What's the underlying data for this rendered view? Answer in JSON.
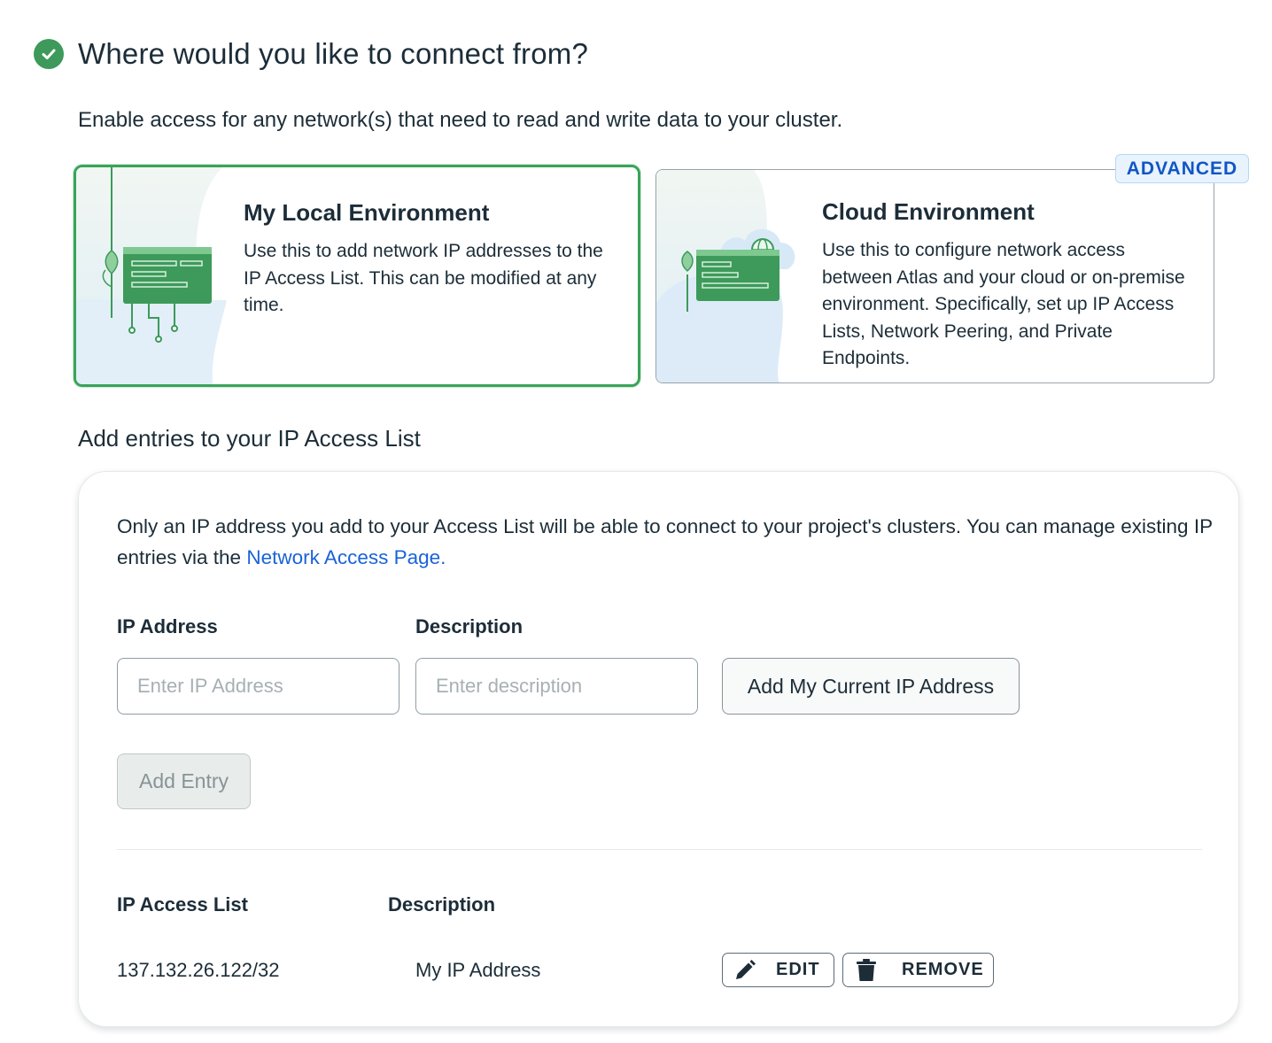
{
  "step": {
    "title": "Where would you like to connect from?",
    "intro": "Enable access for any network(s) that need to read and write data to your cluster."
  },
  "environments": [
    {
      "title": "My Local Environment",
      "description": "Use this to add network IP addresses to the IP Access List. This can be modified at any time.",
      "selected": true
    },
    {
      "title": "Cloud Environment",
      "description": "Use this to configure network access between Atlas and your cloud or on-premise environment. Specifically, set up IP Access Lists, Network Peering, and Private Endpoints.",
      "badge": "ADVANCED",
      "selected": false
    }
  ],
  "access_list_section": {
    "heading": "Add entries to your IP Access List",
    "note_prefix": "Only an IP address you add to your Access List will be able to connect to your project's clusters. You can manage existing IP entries via the ",
    "note_link": "Network Access Page.",
    "form": {
      "ip_label": "IP Address",
      "ip_placeholder": "Enter IP Address",
      "ip_value": "",
      "description_label": "Description",
      "description_placeholder": "Enter description",
      "description_value": "",
      "add_current_ip_button": "Add My Current IP Address",
      "add_entry_button": "Add Entry"
    },
    "list": {
      "columns": [
        "IP Access List",
        "Description"
      ],
      "rows": [
        {
          "ip": "137.132.26.122/32",
          "description": "My IP Address",
          "edit_label": "EDIT",
          "remove_label": "REMOVE"
        }
      ]
    }
  },
  "colors": {
    "success_green": "#3d9a5a",
    "selected_border": "#3aa35a",
    "link_blue": "#1a63d8",
    "badge_blue": "#1255c4",
    "text_dark": "#1c2d38"
  },
  "icons": [
    "check-circle-icon",
    "pencil-icon",
    "trash-icon",
    "globe-icon"
  ]
}
